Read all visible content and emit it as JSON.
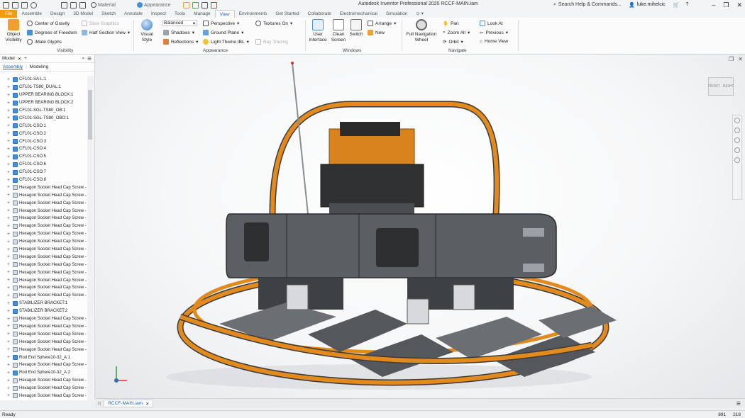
{
  "app": {
    "title": "Autodesk Inventor Professional 2020   RCCF-MAIN.iam",
    "quick_access": {
      "material": "Material",
      "appearance": "Appearance"
    },
    "search_placeholder": "Search Help & Commands...",
    "user": "luke.mihelcic"
  },
  "tabs": [
    "File",
    "Assemble",
    "Design",
    "3D Model",
    "Sketch",
    "Annotate",
    "Inspect",
    "Tools",
    "Manage",
    "View",
    "Environments",
    "Get Started",
    "Collaborate",
    "Electromechanical",
    "Simulation"
  ],
  "active_tab": "View",
  "ribbon": {
    "visibility": {
      "object_visibility": "Object\nVisibility",
      "center_of_gravity": "Center of Gravity",
      "degrees_of_freedom": "Degrees of Freedom",
      "imate_glyphs": "iMate Glyphs",
      "slice_graphics": "Slice Graphics",
      "half_section_view": "Half Section View",
      "group_label": "Visibility"
    },
    "appearance": {
      "visual_style": "Visual Style",
      "balanced": "Balanced",
      "shadows": "Shadows",
      "reflections": "Reflections",
      "perspective": "Perspective",
      "ground_plane": "Ground Plane",
      "light_theme": "Light Theme IBL",
      "textures_on": "Textures On",
      "ray_tracing": "Ray Tracing",
      "group_label": "Appearance"
    },
    "windows": {
      "user_interface": "User\nInterface",
      "clean_screen": "Clean\nScreen",
      "switch": "Switch",
      "arrange": "Arrange",
      "new": "New",
      "group_label": "Windows"
    },
    "navigate": {
      "full_navigation_wheel": "Full Navigation\nWheel",
      "pan": "Pan",
      "zoom_all": "Zoom All",
      "orbit": "Orbit",
      "look_at": "Look At",
      "previous": "Previous",
      "home_view": "Home View",
      "group_label": "Navigate"
    }
  },
  "model_panel": {
    "title": "Model",
    "subtabs": [
      "Assembly",
      "Modeling"
    ],
    "tree": [
      "CF101-SA-L:1",
      "CF101-TS80_DUAL:1",
      "UPPER BEARING BLOCK:1",
      "UPPER BEARING BLOCK:2",
      "CF101-SGL-TS80_OB:1",
      "CF101-SGL-TS80_OBO:1",
      "CF101-CSO:1",
      "CF101-CSO:2",
      "CF101-CSO:3",
      "CF101-CSO:4",
      "CF101-CSO:5",
      "CF101-CSO:6",
      "CF101-CSO:7",
      "CF101-CSO:8",
      "Hexagon Socket Head Cap Screw -",
      "Hexagon Socket Head Cap Screw -",
      "Hexagon Socket Head Cap Screw -",
      "Hexagon Socket Head Cap Screw -",
      "Hexagon Socket Head Cap Screw -",
      "Hexagon Socket Head Cap Screw -",
      "Hexagon Socket Head Cap Screw -",
      "Hexagon Socket Head Cap Screw -",
      "Hexagon Socket Head Cap Screw -",
      "Hexagon Socket Head Cap Screw -",
      "Hexagon Socket Head Cap Screw -",
      "Hexagon Socket Head Cap Screw -",
      "Hexagon Socket Head Cap Screw -",
      "Hexagon Socket Head Cap Screw -",
      "Hexagon Socket Head Cap Screw -",
      "STABILIZER BRACKET:1",
      "STABILIZER BRACKET:2",
      "Hexagon Socket Head Cap Screw -",
      "Hexagon Socket Head Cap Screw -",
      "Hexagon Socket Head Cap Screw -",
      "Hexagon Socket Head Cap Screw -",
      "Hexagon Socket Head Cap Screw -",
      "Rod End Sphere10-32_A:1",
      "Hexagon Socket Head Cap Screw -",
      "Rod End Sphere10-32_A:2",
      "Hexagon Socket Head Cap Screw -",
      "Hexagon Socket Head Cap Screw -",
      "Hexagon Socket Head Cap Screw -"
    ]
  },
  "viewcube": {
    "front": "FRONT",
    "right": "RIGHT"
  },
  "doc_tab": "RCCF-MAIN.iam",
  "status": {
    "text": "Ready",
    "num1": "891",
    "num2": "218"
  },
  "colors": {
    "frame_orange": "#e38a1e",
    "body_gray": "#5b5e62",
    "accent": "#1a5aa5",
    "file_tab": "#f39c12"
  }
}
